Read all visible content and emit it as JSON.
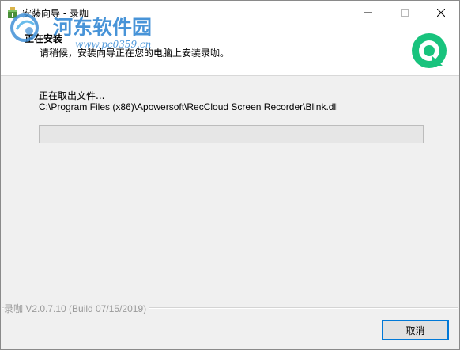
{
  "window": {
    "title": "安装向导 - 录咖",
    "minimize_glyph": "—",
    "maximize_glyph": "☐",
    "close_glyph": "✕"
  },
  "header": {
    "title": "正在安装",
    "subtitle": "请稍候，安装向导正在您的电脑上安装录咖。",
    "logo_icon": "reccloud-logo-icon",
    "logo_color": "#18c37d"
  },
  "watermark": {
    "text": "河东软件园",
    "url": "www.pc0359.cn"
  },
  "content": {
    "status": "正在取出文件...",
    "file_path": "C:\\Program Files (x86)\\Apowersoft\\RecCloud Screen Recorder\\Blink.dll",
    "progress_percent": 0
  },
  "footer": {
    "brand": "录咖 V2.0.7.10  (Build 07/15/2019)",
    "cancel_label": "取消"
  },
  "colors": {
    "accent": "#0078d7",
    "watermark": "#3f8fd6",
    "logo_green": "#18c37d"
  }
}
